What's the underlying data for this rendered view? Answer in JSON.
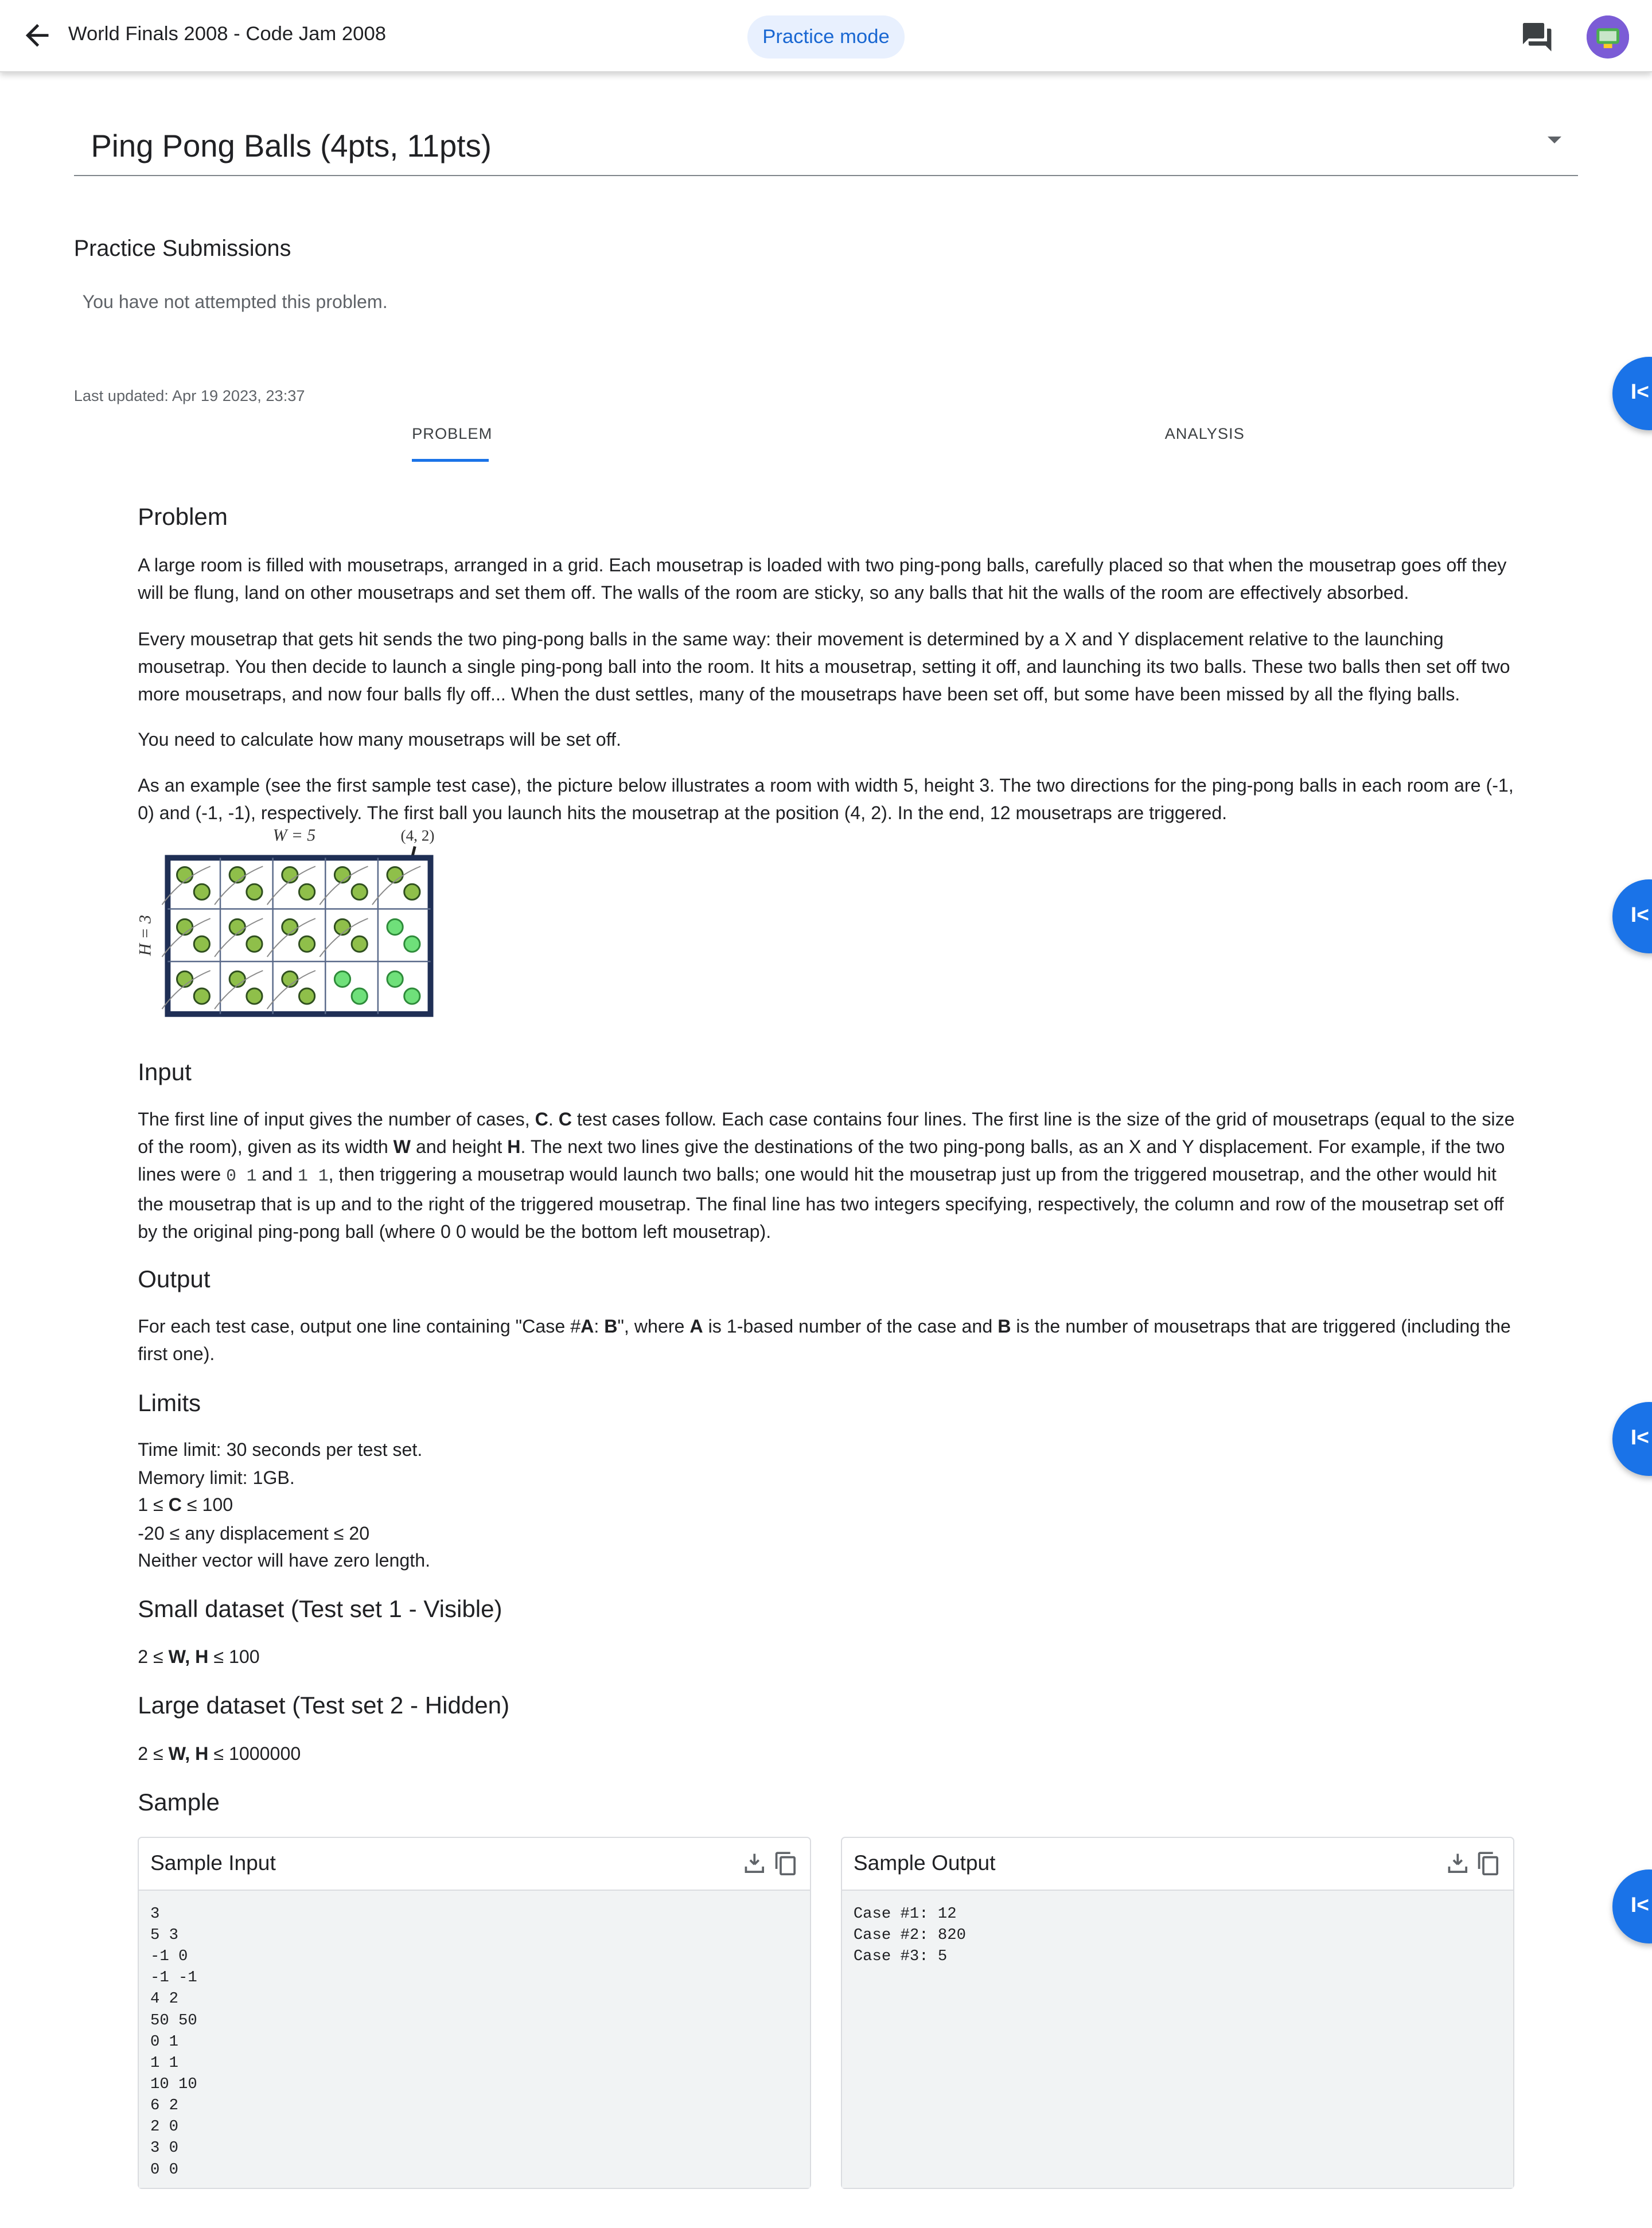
{
  "header": {
    "contest_title": "World Finals 2008 - Code Jam 2008",
    "mode_badge": "Practice mode"
  },
  "problem_selector": {
    "title": "Ping Pong Balls (4pts, 11pts)"
  },
  "submissions": {
    "heading": "Practice Submissions",
    "empty_text": "You have not attempted this problem."
  },
  "last_updated": "Last updated: Apr 19 2023, 23:37",
  "tabs": {
    "problem": "PROBLEM",
    "analysis": "ANALYSIS"
  },
  "sections": {
    "problem": {
      "heading": "Problem",
      "p1": "A large room is filled with mousetraps, arranged in a grid. Each mousetrap is loaded with two ping-pong balls, carefully placed so that when the mousetrap goes off they will be flung, land on other mousetraps and set them off. The walls of the room are sticky, so any balls that hit the walls of the room are effectively absorbed.",
      "p2": "Every mousetrap that gets hit sends the two ping-pong balls in the same way: their movement is determined by a X and Y displacement relative to the launching mousetrap. You then decide to launch a single ping-pong ball into the room. It hits a mousetrap, setting it off, and launching its two balls. These two balls then set off two more mousetraps, and now four balls fly off... When the dust settles, many of the mousetraps have been set off, but some have been missed by all the flying balls.",
      "p3": "You need to calculate how many mousetraps will be set off.",
      "p4": "As an example (see the first sample test case), the picture below illustrates a room with width 5, height 3. The two directions for the ping-pong balls in each room are (-1, 0) and (-1, -1), respectively. The first ball you launch hits the mousetrap at the position (4, 2). In the end, 12 mousetraps are triggered."
    },
    "figure": {
      "width_label": "W = 5",
      "height_label": "H = 3",
      "pos_label": "(4, 2)"
    },
    "input": {
      "heading": "Input",
      "t1": "The first line of input gives the number of cases, ",
      "t_c1": "C",
      "t2": ". ",
      "t_c2": "C",
      "t3": " test cases follow. Each case contains four lines. The first line is the size of the grid of mousetraps (equal to the size of the room), given as its width ",
      "t_w": "W",
      "t4": " and height ",
      "t_h": "H",
      "t5": ". The next two lines give the destinations of the two ping-pong balls, as an X and Y displacement. For example, if the two lines were ",
      "code1": "0 1",
      "t6": " and ",
      "code2": "1 1",
      "t7": ", then triggering a mousetrap would launch two balls; one would hit the mousetrap just up from the triggered mousetrap, and the other would hit the mousetrap that is up and to the right of the triggered mousetrap. The final line has two integers specifying, respectively, the column and row of the mousetrap set off by the original ping-pong ball (where 0 0 would be the bottom left mousetrap)."
    },
    "output": {
      "heading": "Output",
      "t1": "For each test case, output one line containing \"Case #",
      "t_a": "A",
      "t2": ": ",
      "t_b": "B",
      "t3": "\", where ",
      "t_a2": "A",
      "t4": " is 1-based number of the case and ",
      "t_b2": "B",
      "t5": " is the number of mousetraps that are triggered (including the first one)."
    },
    "limits": {
      "heading": "Limits",
      "l1": "Time limit: 30 seconds per test set.",
      "l2": "Memory limit: 1GB.",
      "l3a": "1 ≤ ",
      "l3b": "C",
      "l3c": " ≤ 100",
      "l4": "-20 ≤ any displacement ≤ 20",
      "l5": "Neither vector will have zero length."
    },
    "small": {
      "heading": "Small dataset (Test set 1 - Visible)",
      "a": "2 ≤ ",
      "b": "W, H",
      "c": " ≤ 100"
    },
    "large": {
      "heading": "Large dataset (Test set 2 - Hidden)",
      "a": "2 ≤ ",
      "b": "W, H",
      "c": " ≤ 1000000"
    },
    "sample": {
      "heading": "Sample",
      "input_title": "Sample Input",
      "input_text": "3\n5 3\n-1 0\n-1 -1\n4 2\n50 50\n0 1\n1 1\n10 10\n6 2\n2 0\n3 0\n0 0",
      "output_title": "Sample Output",
      "output_text": "Case #1: 12\nCase #2: 820\nCase #3: 5"
    }
  },
  "icons": {
    "back": "arrow-back-icon",
    "chat": "chat-icon",
    "download": "download-icon",
    "copy": "copy-icon",
    "side": "first-page-icon"
  },
  "colors": {
    "accent": "#1a73e8",
    "pill_bg": "#e8f0fe",
    "pill_text": "#1967d2"
  }
}
